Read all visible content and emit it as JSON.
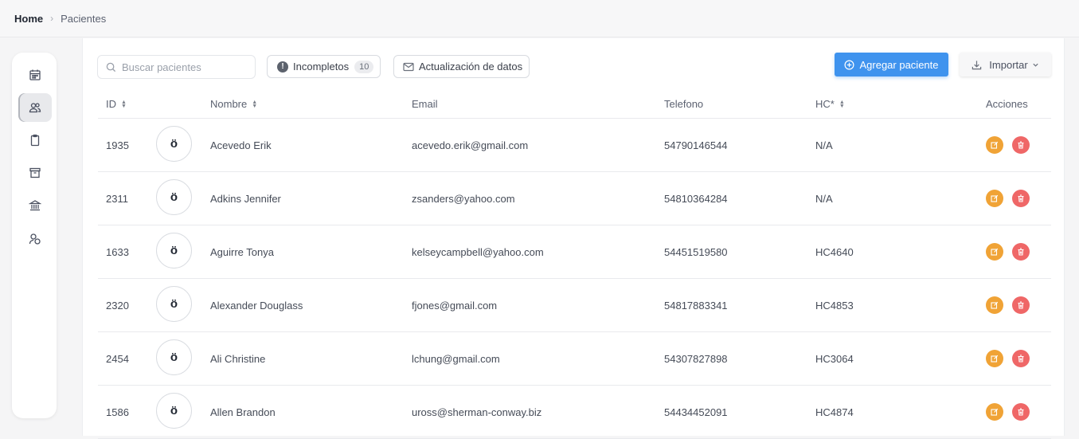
{
  "breadcrumb": {
    "home": "Home",
    "current": "Pacientes"
  },
  "sidebar": {
    "items": [
      {
        "icon": "calendar-icon",
        "active": false
      },
      {
        "icon": "users-icon",
        "active": true
      },
      {
        "icon": "clipboard-icon",
        "active": false
      },
      {
        "icon": "archive-icon",
        "active": false
      },
      {
        "icon": "bank-icon",
        "active": false
      },
      {
        "icon": "user-group-icon",
        "active": false
      }
    ]
  },
  "toolbar": {
    "search_placeholder": "Buscar pacientes",
    "incompletos_label": "Incompletos",
    "incompletos_count": "10",
    "actualizacion_label": "Actualización de datos",
    "agregar_label": "Agregar paciente",
    "importar_label": "Importar"
  },
  "table": {
    "headers": {
      "id": "ID",
      "nombre": "Nombre",
      "email": "Email",
      "telefono": "Telefono",
      "hc": "HC*",
      "acciones": "Acciones"
    },
    "rows": [
      {
        "id": "1935",
        "avatar": "ö",
        "nombre": "Acevedo Erik",
        "email": "acevedo.erik@gmail.com",
        "telefono": "54790146544",
        "hc": "N/A"
      },
      {
        "id": "2311",
        "avatar": "ö",
        "nombre": "Adkins Jennifer",
        "email": "zsanders@yahoo.com",
        "telefono": "54810364284",
        "hc": "N/A"
      },
      {
        "id": "1633",
        "avatar": "ö",
        "nombre": "Aguirre Tonya",
        "email": "kelseycampbell@yahoo.com",
        "telefono": "54451519580",
        "hc": "HC4640"
      },
      {
        "id": "2320",
        "avatar": "ö",
        "nombre": "Alexander Douglass",
        "email": "fjones@gmail.com",
        "telefono": "54817883341",
        "hc": "HC4853"
      },
      {
        "id": "2454",
        "avatar": "ö",
        "nombre": "Ali Christine",
        "email": "lchung@gmail.com",
        "telefono": "54307827898",
        "hc": "HC3064"
      },
      {
        "id": "1586",
        "avatar": "ö",
        "nombre": "Allen Brandon",
        "email": "uross@sherman-conway.biz",
        "telefono": "54434452091",
        "hc": "HC4874"
      }
    ]
  },
  "colors": {
    "primary": "#3f93ee",
    "edit": "#f0a336",
    "delete": "#ef6767"
  }
}
